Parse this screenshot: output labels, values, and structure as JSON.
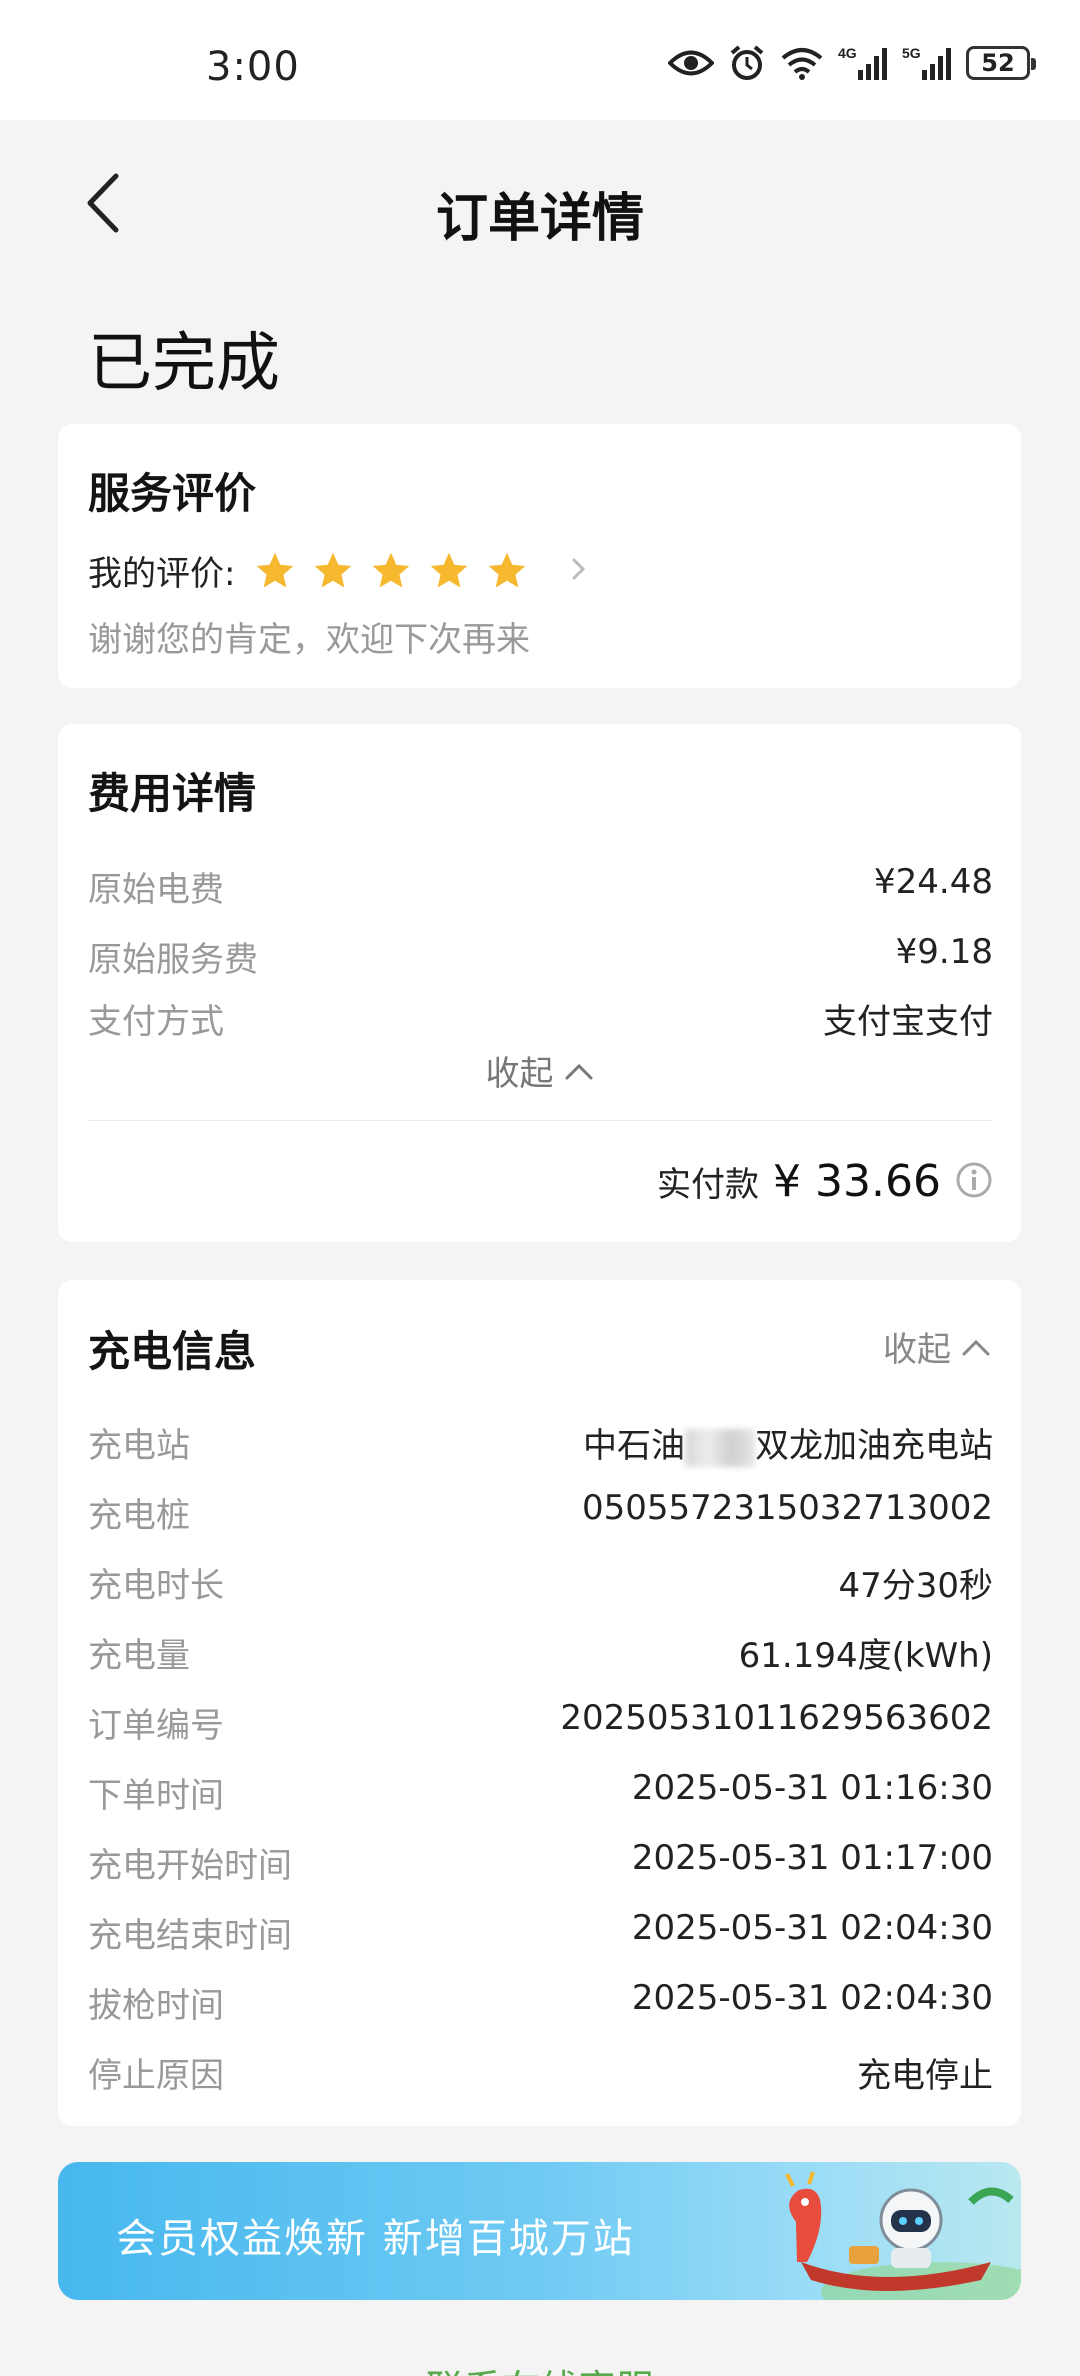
{
  "status_bar": {
    "time": "3:00",
    "battery": "52"
  },
  "nav": {
    "title": "订单详情"
  },
  "order_status": "已完成",
  "rating_card": {
    "title": "服务评价",
    "my_rating_label": "我的评价:",
    "stars": 5,
    "note": "谢谢您的肯定，欢迎下次再来"
  },
  "fee_card": {
    "title": "费用详情",
    "rows": [
      {
        "label": "原始电费",
        "value": "¥24.48"
      },
      {
        "label": "原始服务费",
        "value": "¥9.18"
      },
      {
        "label": "支付方式",
        "value": "支付宝支付"
      }
    ],
    "collapse_label": "收起",
    "paid_label": "实付款",
    "paid_amount": "¥ 33.66"
  },
  "charge_card": {
    "title": "充电信息",
    "collapse_label": "收起",
    "station": {
      "label": "充电站",
      "value_prefix": "中石油",
      "value_suffix": "双龙加油充电站"
    },
    "rows": [
      {
        "label": "充电桩",
        "value": "0505572315032713002"
      },
      {
        "label": "充电时长",
        "value": "47分30秒"
      },
      {
        "label": "充电量",
        "value": "61.194度(kWh)"
      },
      {
        "label": "订单编号",
        "value": "20250531011629563602"
      },
      {
        "label": "下单时间",
        "value": "2025-05-31 01:16:30"
      },
      {
        "label": "充电开始时间",
        "value": "2025-05-31 01:17:00"
      },
      {
        "label": "充电结束时间",
        "value": "2025-05-31 02:04:30"
      },
      {
        "label": "拔枪时间",
        "value": "2025-05-31 02:04:30"
      },
      {
        "label": "停止原因",
        "value": "充电停止"
      }
    ]
  },
  "banner": {
    "text": "会员权益焕新 新增百城万站"
  },
  "footer": {
    "link": "联系在线客服"
  },
  "colors": {
    "star": "#f5b82e",
    "accent_green": "#58a84c",
    "banner_blue": "#46b8ee"
  },
  "icons": [
    "eye-icon",
    "alarm-icon",
    "wifi-icon",
    "signal-4g-icon",
    "signal-5g-icon",
    "back-arrow-icon",
    "star-icon",
    "chevron-right-icon",
    "chevron-up-icon",
    "info-icon"
  ]
}
